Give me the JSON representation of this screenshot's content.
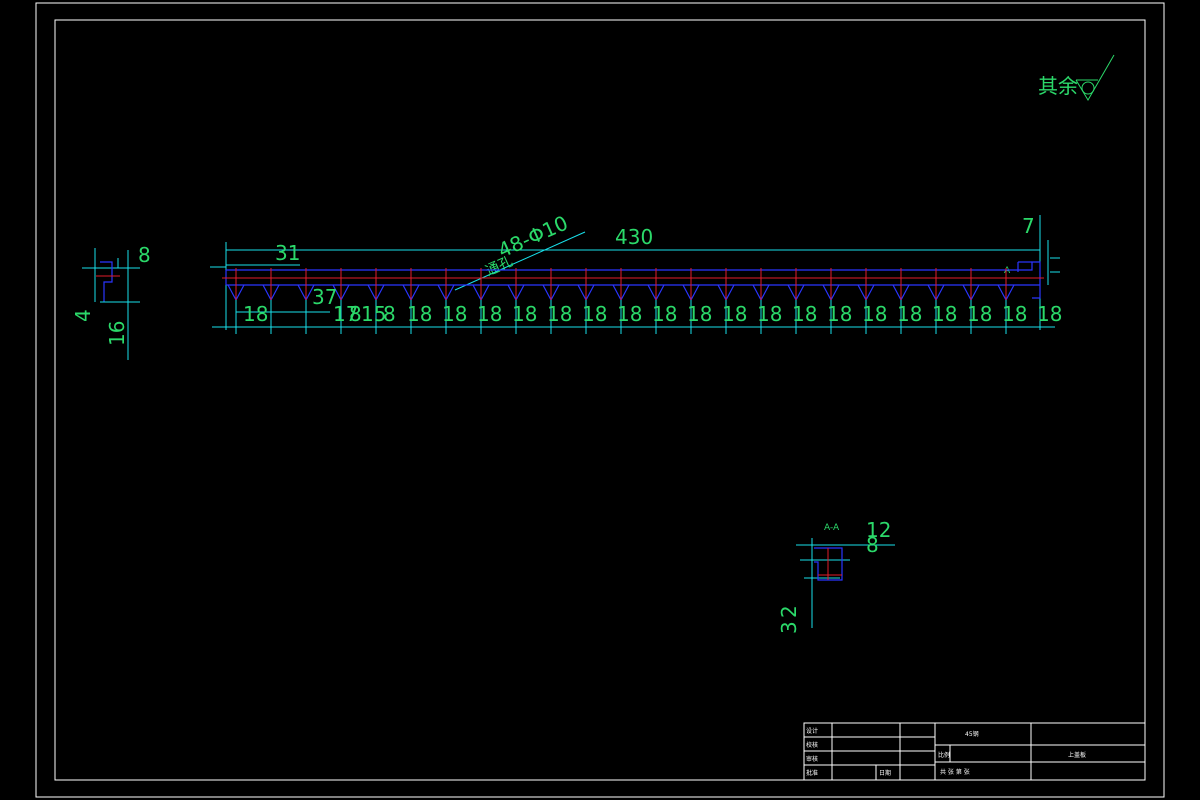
{
  "drawing": {
    "roughness_note": "其余",
    "main_view": {
      "overall_length": "430",
      "left_offset": "31",
      "hole_callout": "48-Φ10",
      "callout_sub": "通孔",
      "offset_37": "37",
      "first_spacing": "18",
      "spacing_a": "17",
      "spacing_b": "8",
      "spacing_c": "15",
      "spacing_d": "8",
      "pitch_labels": [
        "18",
        "18",
        "18",
        "18",
        "18",
        "18",
        "18",
        "18",
        "18",
        "18",
        "18",
        "18",
        "18",
        "18",
        "18",
        "18",
        "18",
        "18",
        "18"
      ],
      "right_height": "7",
      "small_a": "A"
    },
    "side_view": {
      "width": "8",
      "height_a": "4",
      "height_b": "16"
    },
    "section_view": {
      "label": "A-A",
      "dim_top": "12",
      "dim_mid": "8",
      "dim_left_a": "3",
      "dim_left_b": "2"
    }
  },
  "title_block": {
    "designer": "设计",
    "checker": "校核",
    "reviewer": "审核",
    "approver": "批准",
    "date_label": "日期",
    "part_name": "45钢",
    "material_label": "比例",
    "scale_row": "共   张  第   张",
    "drawing_name": "上盖板"
  }
}
